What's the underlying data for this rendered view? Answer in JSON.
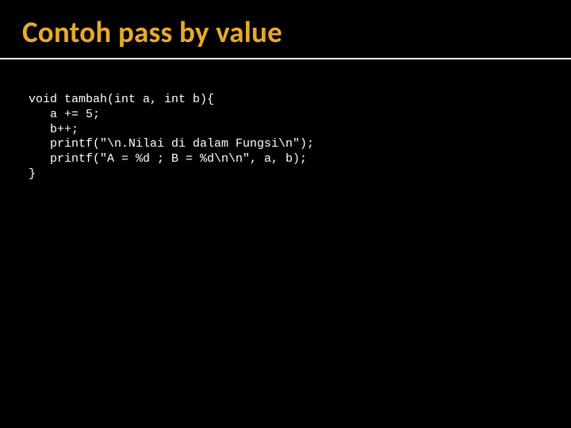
{
  "slide": {
    "title": "Contoh pass by value",
    "code": {
      "line1": "void tambah(int a, int b){",
      "line2": "   a += 5;",
      "line3": "   b++;",
      "line4": "   printf(\"\\n.Nilai di dalam Fungsi\\n\");",
      "line5": "   printf(\"A = %d ; B = %d\\n\\n\", a, b);",
      "line6": "}"
    }
  }
}
